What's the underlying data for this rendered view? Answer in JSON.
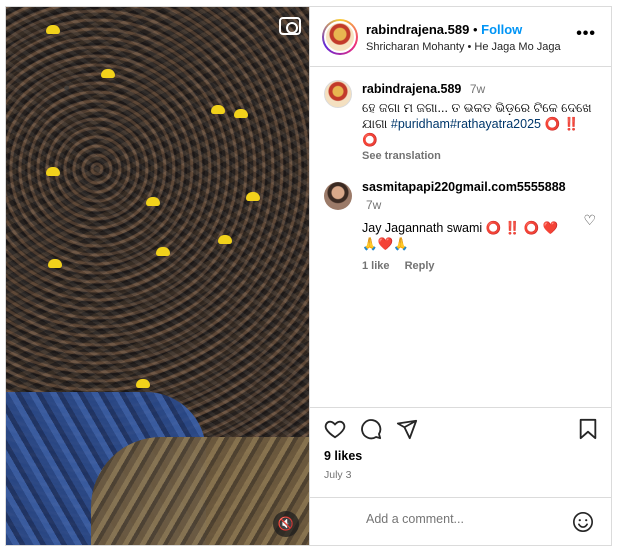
{
  "post": {
    "username": "rabindrajena.589",
    "follow_label": "Follow",
    "audio": "Shricharan Mohanty • He Jaga Mo Jaga",
    "more_label": "•••"
  },
  "comments": [
    {
      "username": "rabindrajena.589",
      "ago": "7w",
      "text_plain": "ହେ ଜଗା ମ ଜଗା... ତ ଭକତ ଭିଡ଼ରେ ଟିକେ ଦେଖେ ଯାଗା",
      "hashtags": "#puridham#rathayatra2025",
      "trailing": " ⭕ ‼️ ⭕",
      "see_translation": "See translation"
    },
    {
      "username": "sasmitapapi220gmail.com5555888",
      "ago": "7w",
      "text": "Jay Jagannath swami ⭕ ‼️ ⭕ ❤️ 🙏❤️🙏",
      "likes": "1 like",
      "reply": "Reply"
    }
  ],
  "likes_text": "9 likes",
  "date_text": "July 3",
  "add_comment_placeholder": "Add a comment...",
  "colors": {
    "follow": "#0095f6",
    "hashtag": "#00376b",
    "muted": "#737373"
  }
}
